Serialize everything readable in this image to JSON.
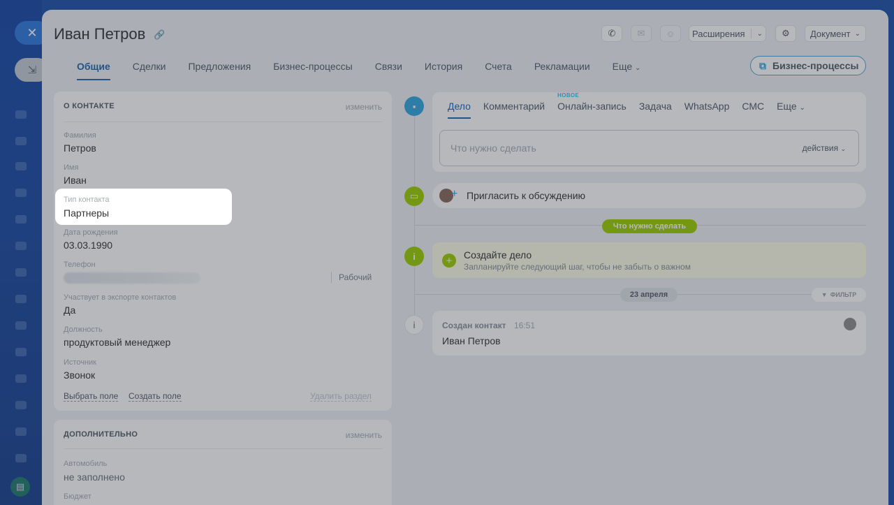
{
  "app": {
    "close_icon": "close-icon",
    "minimize_icon": "minimize-icon"
  },
  "header": {
    "title": "Иван Петров",
    "extensions_label": "Расширения",
    "document_label": "Документ"
  },
  "tabs": [
    {
      "label": "Общие"
    },
    {
      "label": "Сделки"
    },
    {
      "label": "Предложения"
    },
    {
      "label": "Бизнес-процессы"
    },
    {
      "label": "Связи"
    },
    {
      "label": "История"
    },
    {
      "label": "Счета"
    },
    {
      "label": "Рекламации"
    },
    {
      "label": "Еще"
    }
  ],
  "bp_button": "Бизнес-процессы",
  "about": {
    "title": "О КОНТАКТЕ",
    "edit": "изменить",
    "fields": {
      "last_name_label": "Фамилия",
      "last_name": "Петров",
      "first_name_label": "Имя",
      "first_name": "Иван",
      "type_label": "Тип контакта",
      "type": "Партнеры",
      "birth_label": "Дата рождения",
      "birth": "03.03.1990",
      "phone_label": "Телефон",
      "phone_type": "Рабочий",
      "export_label": "Участвует в экспорте контактов",
      "export": "Да",
      "position_label": "Должность",
      "position": "продуктовый менеджер",
      "source_label": "Источник",
      "source": "Звонок"
    },
    "select_field": "Выбрать поле",
    "create_field": "Создать поле",
    "delete_section": "Удалить раздел"
  },
  "extra": {
    "title": "ДОПОЛНИТЕЛЬНО",
    "edit": "изменить",
    "car_label": "Автомобиль",
    "car": "не заполнено",
    "budget_label": "Бюджет"
  },
  "activity": {
    "tabs": [
      "Дело",
      "Комментарий",
      "Онлайн-запись",
      "Задача",
      "WhatsApp",
      "СМС",
      "Еще"
    ],
    "new_badge": "НОВОЕ",
    "todo_placeholder": "Что нужно сделать",
    "actions": "действия"
  },
  "invite": "Пригласить к обсуждению",
  "todo_pill": "Что нужно сделать",
  "create_case": {
    "title": "Создайте дело",
    "subtitle": "Запланируйте следующий шаг, чтобы не забыть о важном"
  },
  "date_pill": "23 апреля",
  "filter": "ФИЛЬТР",
  "history_item": {
    "title": "Создан контакт",
    "time": "16:51",
    "name": "Иван Петров"
  }
}
